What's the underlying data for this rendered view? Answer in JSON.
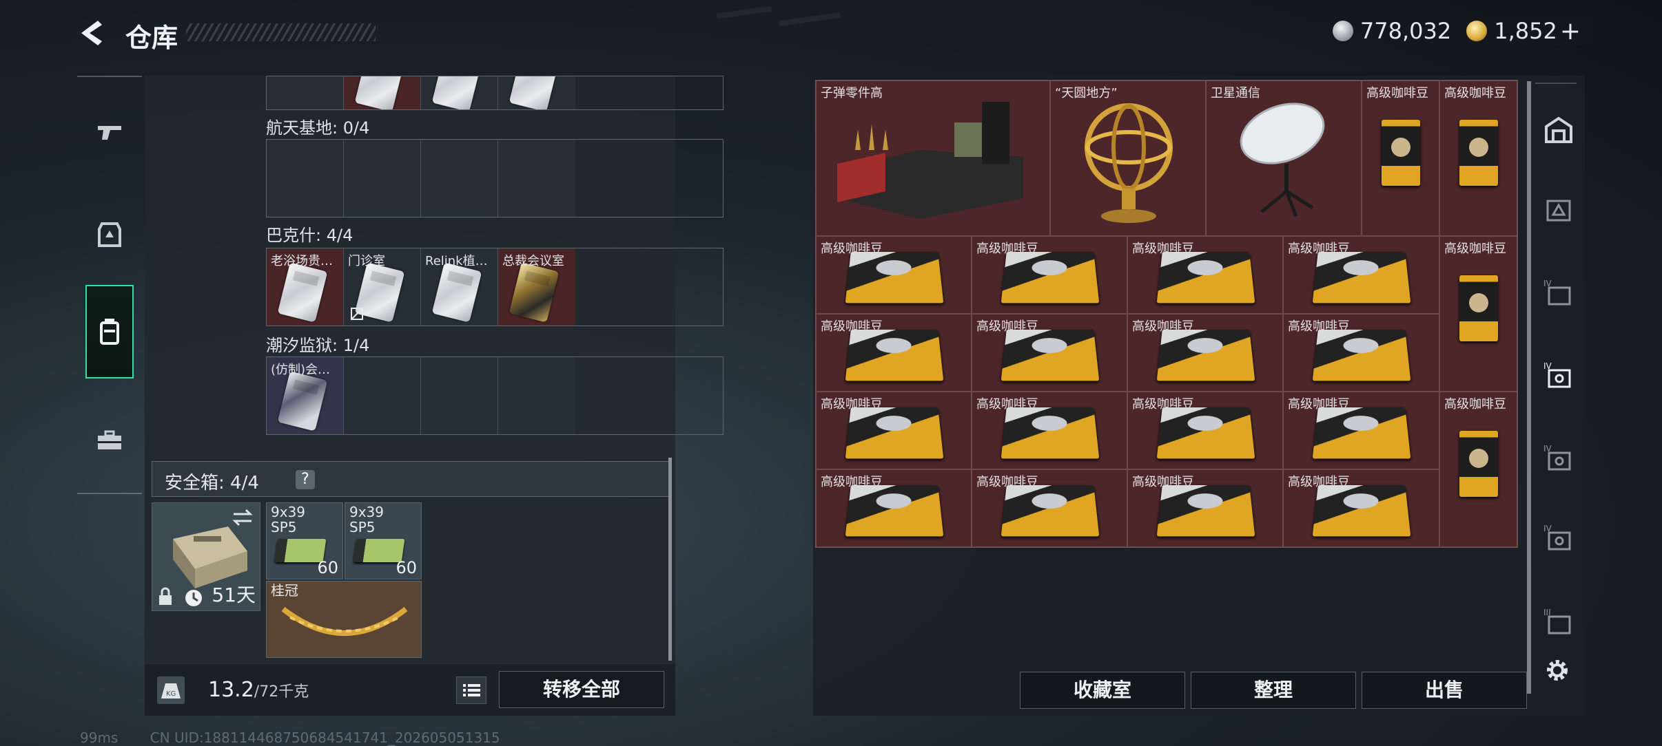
{
  "header": {
    "title": "仓库"
  },
  "currency": {
    "silver": "778,032",
    "gold": "1,852",
    "plus": "+"
  },
  "left_nav": [
    "weapon-tab",
    "armor-tab",
    "backpack-tab",
    "toolbox-tab"
  ],
  "stash": {
    "sections": [
      {
        "title": "航天基地: 0/4",
        "slots": [
          "",
          "",
          "",
          ""
        ]
      },
      {
        "title": "巴克什: 4/4",
        "slots": [
          "老浴场贵…",
          "门诊室",
          "Relink植…",
          "总裁会议室"
        ]
      },
      {
        "title": "潮汐监狱: 1/4",
        "slots": [
          "(仿制)会…",
          "",
          "",
          ""
        ]
      }
    ]
  },
  "safe": {
    "label": "安全箱:  4/4",
    "help": "?",
    "days": "51天",
    "ammo1": {
      "name": "9x39\nSP5",
      "count": "60"
    },
    "ammo2": {
      "name": "9x39\nSP5",
      "count": "60"
    },
    "crown": "桂冠"
  },
  "bottom": {
    "weight": "13.2",
    "weight_max": "/72千克",
    "transfer_all": "转移全部"
  },
  "grid": {
    "top": [
      "子弹零件高",
      "“天圆地方”",
      "卫星通信",
      "高级咖啡豆",
      "高级咖啡豆"
    ],
    "coffee": "高级咖啡豆"
  },
  "actions": {
    "collection": "收藏室",
    "sort": "整理",
    "sell": "出售"
  },
  "status": {
    "ping": "99ms",
    "uid": "CN UID:188114468750684541741_202605051315"
  },
  "colors": {
    "accent": "#2fe3a2",
    "cell_red": "#4c2628"
  }
}
